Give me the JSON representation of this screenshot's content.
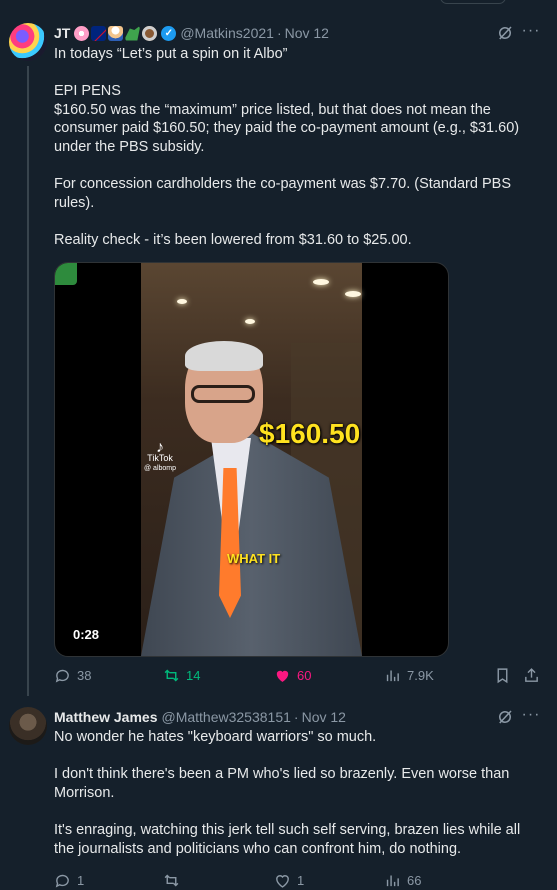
{
  "tweets": [
    {
      "author": {
        "name": "JT",
        "emoji_icons": [
          "cherry-blossom-icon",
          "australia-flag-icon",
          "chef-icon",
          "dinosaur-icon",
          "rugby-ball-icon"
        ],
        "verified": true,
        "handle": "@Matkins2021",
        "separator": "·",
        "time": "Nov 12"
      },
      "lines": [
        "In todays “Let’s put a spin on it Albo”",
        "",
        "EPI PENS",
        "$160.50 was the “maximum” price listed, but that does not mean the",
        "consumer paid $160.50; they paid the co-payment amount (e.g., $31.60)",
        "under the PBS subsidy.",
        "",
        "For concession cardholders the co-payment was $7.70. (Standard PBS",
        "rules).",
        "",
        "Reality check - it’s been lowered from $31.60 to $25.00."
      ],
      "media": {
        "type": "video",
        "overlay_price": "$160.50",
        "overlay_caption": "WHAT IT",
        "watermark": "TikTok",
        "watermark_handle": "@ albomp",
        "duration": "0:28"
      },
      "actions": {
        "replies": "38",
        "retweets": "14",
        "likes": "60",
        "views": "7.9K"
      }
    },
    {
      "author": {
        "name": "Matthew James",
        "handle": "@Matthew32538151",
        "separator": "·",
        "time": "Nov 12"
      },
      "lines": [
        "No wonder he hates \"keyboard warriors\" so much.",
        "",
        "I don't think there's been a PM who's lied so brazenly. Even worse than",
        "Morrison.",
        "",
        "It's enraging, watching this jerk tell such self serving, brazen lies while all",
        "the journalists and politicians who can confront him, do nothing."
      ],
      "actions": {
        "replies": "1",
        "retweets": "",
        "likes": "1",
        "views": "66"
      }
    }
  ],
  "colors": {
    "background": "#15202b",
    "text": "#e7e9ea",
    "muted": "#8b98a5",
    "verified": "#1d9bf0",
    "retweet_active": "#00ba7c",
    "like_active": "#f91880"
  }
}
